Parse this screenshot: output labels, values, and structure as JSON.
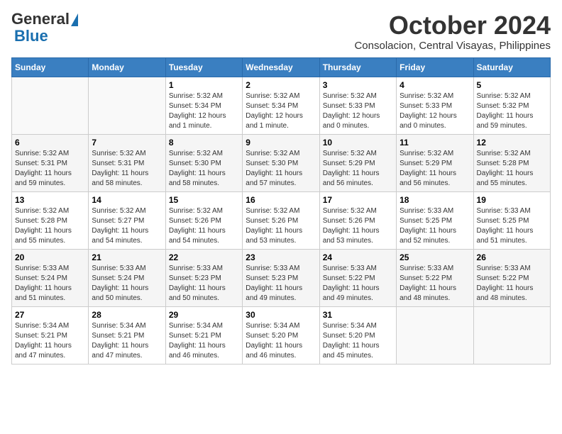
{
  "header": {
    "logo_general": "General",
    "logo_blue": "Blue",
    "month": "October 2024",
    "location": "Consolacion, Central Visayas, Philippines"
  },
  "columns": [
    "Sunday",
    "Monday",
    "Tuesday",
    "Wednesday",
    "Thursday",
    "Friday",
    "Saturday"
  ],
  "weeks": [
    [
      {
        "day": "",
        "info": ""
      },
      {
        "day": "",
        "info": ""
      },
      {
        "day": "1",
        "info": "Sunrise: 5:32 AM\nSunset: 5:34 PM\nDaylight: 12 hours\nand 1 minute."
      },
      {
        "day": "2",
        "info": "Sunrise: 5:32 AM\nSunset: 5:34 PM\nDaylight: 12 hours\nand 1 minute."
      },
      {
        "day": "3",
        "info": "Sunrise: 5:32 AM\nSunset: 5:33 PM\nDaylight: 12 hours\nand 0 minutes."
      },
      {
        "day": "4",
        "info": "Sunrise: 5:32 AM\nSunset: 5:33 PM\nDaylight: 12 hours\nand 0 minutes."
      },
      {
        "day": "5",
        "info": "Sunrise: 5:32 AM\nSunset: 5:32 PM\nDaylight: 11 hours\nand 59 minutes."
      }
    ],
    [
      {
        "day": "6",
        "info": "Sunrise: 5:32 AM\nSunset: 5:31 PM\nDaylight: 11 hours\nand 59 minutes."
      },
      {
        "day": "7",
        "info": "Sunrise: 5:32 AM\nSunset: 5:31 PM\nDaylight: 11 hours\nand 58 minutes."
      },
      {
        "day": "8",
        "info": "Sunrise: 5:32 AM\nSunset: 5:30 PM\nDaylight: 11 hours\nand 58 minutes."
      },
      {
        "day": "9",
        "info": "Sunrise: 5:32 AM\nSunset: 5:30 PM\nDaylight: 11 hours\nand 57 minutes."
      },
      {
        "day": "10",
        "info": "Sunrise: 5:32 AM\nSunset: 5:29 PM\nDaylight: 11 hours\nand 56 minutes."
      },
      {
        "day": "11",
        "info": "Sunrise: 5:32 AM\nSunset: 5:29 PM\nDaylight: 11 hours\nand 56 minutes."
      },
      {
        "day": "12",
        "info": "Sunrise: 5:32 AM\nSunset: 5:28 PM\nDaylight: 11 hours\nand 55 minutes."
      }
    ],
    [
      {
        "day": "13",
        "info": "Sunrise: 5:32 AM\nSunset: 5:28 PM\nDaylight: 11 hours\nand 55 minutes."
      },
      {
        "day": "14",
        "info": "Sunrise: 5:32 AM\nSunset: 5:27 PM\nDaylight: 11 hours\nand 54 minutes."
      },
      {
        "day": "15",
        "info": "Sunrise: 5:32 AM\nSunset: 5:26 PM\nDaylight: 11 hours\nand 54 minutes."
      },
      {
        "day": "16",
        "info": "Sunrise: 5:32 AM\nSunset: 5:26 PM\nDaylight: 11 hours\nand 53 minutes."
      },
      {
        "day": "17",
        "info": "Sunrise: 5:32 AM\nSunset: 5:26 PM\nDaylight: 11 hours\nand 53 minutes."
      },
      {
        "day": "18",
        "info": "Sunrise: 5:33 AM\nSunset: 5:25 PM\nDaylight: 11 hours\nand 52 minutes."
      },
      {
        "day": "19",
        "info": "Sunrise: 5:33 AM\nSunset: 5:25 PM\nDaylight: 11 hours\nand 51 minutes."
      }
    ],
    [
      {
        "day": "20",
        "info": "Sunrise: 5:33 AM\nSunset: 5:24 PM\nDaylight: 11 hours\nand 51 minutes."
      },
      {
        "day": "21",
        "info": "Sunrise: 5:33 AM\nSunset: 5:24 PM\nDaylight: 11 hours\nand 50 minutes."
      },
      {
        "day": "22",
        "info": "Sunrise: 5:33 AM\nSunset: 5:23 PM\nDaylight: 11 hours\nand 50 minutes."
      },
      {
        "day": "23",
        "info": "Sunrise: 5:33 AM\nSunset: 5:23 PM\nDaylight: 11 hours\nand 49 minutes."
      },
      {
        "day": "24",
        "info": "Sunrise: 5:33 AM\nSunset: 5:22 PM\nDaylight: 11 hours\nand 49 minutes."
      },
      {
        "day": "25",
        "info": "Sunrise: 5:33 AM\nSunset: 5:22 PM\nDaylight: 11 hours\nand 48 minutes."
      },
      {
        "day": "26",
        "info": "Sunrise: 5:33 AM\nSunset: 5:22 PM\nDaylight: 11 hours\nand 48 minutes."
      }
    ],
    [
      {
        "day": "27",
        "info": "Sunrise: 5:34 AM\nSunset: 5:21 PM\nDaylight: 11 hours\nand 47 minutes."
      },
      {
        "day": "28",
        "info": "Sunrise: 5:34 AM\nSunset: 5:21 PM\nDaylight: 11 hours\nand 47 minutes."
      },
      {
        "day": "29",
        "info": "Sunrise: 5:34 AM\nSunset: 5:21 PM\nDaylight: 11 hours\nand 46 minutes."
      },
      {
        "day": "30",
        "info": "Sunrise: 5:34 AM\nSunset: 5:20 PM\nDaylight: 11 hours\nand 46 minutes."
      },
      {
        "day": "31",
        "info": "Sunrise: 5:34 AM\nSunset: 5:20 PM\nDaylight: 11 hours\nand 45 minutes."
      },
      {
        "day": "",
        "info": ""
      },
      {
        "day": "",
        "info": ""
      }
    ]
  ]
}
